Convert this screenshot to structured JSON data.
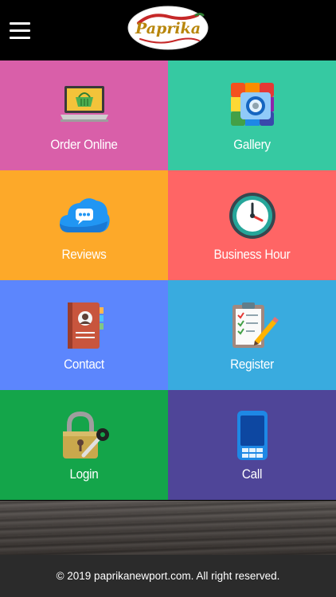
{
  "header": {
    "menu_icon": "hamburger-menu-icon",
    "logo_text": "Paprika"
  },
  "tiles": [
    {
      "label": "Order Online",
      "icon": "laptop-basket-icon",
      "color": "#D95FA9"
    },
    {
      "label": "Gallery",
      "icon": "photo-gallery-icon",
      "color": "#36C9A2"
    },
    {
      "label": "Reviews",
      "icon": "chat-cloud-icon",
      "color": "#FDA929"
    },
    {
      "label": "Business Hour",
      "icon": "clock-icon",
      "color": "#FF6565"
    },
    {
      "label": "Contact",
      "icon": "address-book-icon",
      "color": "#5C86FD"
    },
    {
      "label": "Register",
      "icon": "clipboard-checklist-icon",
      "color": "#39ABDF"
    },
    {
      "label": "Login",
      "icon": "padlock-key-icon",
      "color": "#14A54A"
    },
    {
      "label": "Call",
      "icon": "mobile-phone-icon",
      "color": "#4F4598"
    }
  ],
  "footer": {
    "copyright": "© 2019 paprikanewport.com. All right reserved."
  }
}
